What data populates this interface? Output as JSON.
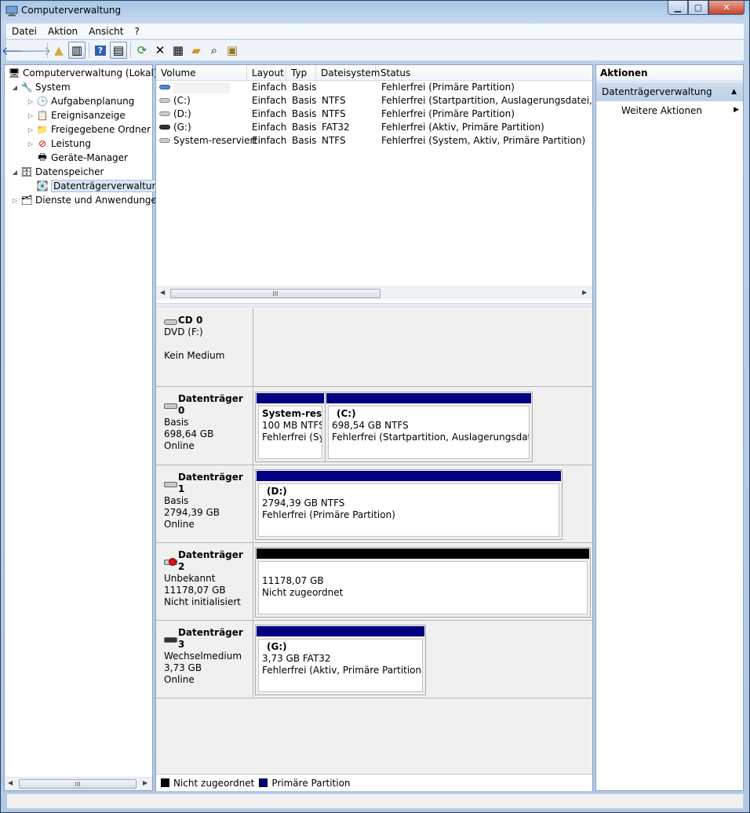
{
  "window": {
    "title": "Computerverwaltung"
  },
  "menu": [
    "Datei",
    "Aktion",
    "Ansicht",
    "?"
  ],
  "toolbar_icons": [
    "back-arrow-icon",
    "forward-arrow-icon",
    "up-folder-icon",
    "show-hide-tree-icon",
    "help-icon",
    "show-hide-action-pane-icon",
    "refresh-icon",
    "delete-icon",
    "properties-icon",
    "open-icon",
    "search-icon",
    "export-icon"
  ],
  "tree": [
    {
      "label": "Computerverwaltung (Lokal)",
      "level": 0,
      "arrow": "",
      "icon": "computer-management-icon"
    },
    {
      "label": "System",
      "level": 1,
      "arrow": "◢",
      "icon": "system-tools-icon"
    },
    {
      "label": "Aufgabenplanung",
      "level": 2,
      "arrow": "▷",
      "icon": "task-scheduler-icon"
    },
    {
      "label": "Ereignisanzeige",
      "level": 2,
      "arrow": "▷",
      "icon": "event-viewer-icon"
    },
    {
      "label": "Freigegebene Ordner",
      "level": 2,
      "arrow": "▷",
      "icon": "shared-folders-icon"
    },
    {
      "label": "Leistung",
      "level": 2,
      "arrow": "▷",
      "icon": "performance-icon"
    },
    {
      "label": "Geräte-Manager",
      "level": 2,
      "arrow": "",
      "icon": "device-manager-icon"
    },
    {
      "label": "Datenspeicher",
      "level": 1,
      "arrow": "◢",
      "icon": "storage-icon"
    },
    {
      "label": "Datenträgerverwaltung",
      "level": 2,
      "arrow": "",
      "icon": "disk-management-icon",
      "selected": true
    },
    {
      "label": "Dienste und Anwendungen",
      "level": 1,
      "arrow": "▷",
      "icon": "services-icon"
    }
  ],
  "volume_table": {
    "columns": [
      "Volume",
      "Layout",
      "Typ",
      "Dateisystem",
      "Status"
    ],
    "rows": [
      {
        "volume": "",
        "layout": "Einfach",
        "typ": "Basis",
        "fs": "",
        "status": "Fehlerfrei (Primäre Partition)",
        "icon": "blue"
      },
      {
        "volume": "(C:)",
        "layout": "Einfach",
        "typ": "Basis",
        "fs": "NTFS",
        "status": "Fehlerfrei (Startpartition, Auslagerungsdatei, Absturz",
        "icon": "gray"
      },
      {
        "volume": "(D:)",
        "layout": "Einfach",
        "typ": "Basis",
        "fs": "NTFS",
        "status": "Fehlerfrei (Primäre Partition)",
        "icon": "gray"
      },
      {
        "volume": "(G:)",
        "layout": "Einfach",
        "typ": "Basis",
        "fs": "FAT32",
        "status": "Fehlerfrei (Aktiv, Primäre Partition)",
        "icon": "dark"
      },
      {
        "volume": "System-reserviert",
        "layout": "Einfach",
        "typ": "Basis",
        "fs": "NTFS",
        "status": "Fehlerfrei (System, Aktiv, Primäre Partition)",
        "icon": "gray"
      }
    ]
  },
  "disks": [
    {
      "name": "CD 0",
      "lines": [
        "DVD (F:)",
        "",
        "Kein Medium"
      ],
      "icon": "cd"
    },
    {
      "name": "Datenträger 0",
      "lines": [
        "Basis",
        "698,64 GB",
        "Online"
      ],
      "icon": "hdd",
      "partitions": [
        {
          "title": "System-reser",
          "size": "100 MB NTFS",
          "status": "Fehlerfrei (Sys",
          "band": "#000080"
        },
        {
          "title": "(C:)",
          "size": "698,54 GB NTFS",
          "status": "Fehlerfrei (Startpartition, Auslagerungsdatei, Ab",
          "band": "#000080"
        }
      ]
    },
    {
      "name": "Datenträger 1",
      "lines": [
        "Basis",
        "2794,39 GB",
        "Online"
      ],
      "icon": "hdd",
      "partitions": [
        {
          "title": "(D:)",
          "size": "2794,39 GB NTFS",
          "status": "Fehlerfrei (Primäre Partition)",
          "band": "#000080"
        }
      ]
    },
    {
      "name": "Datenträger 2",
      "lines": [
        "Unbekannt",
        "11178,07 GB",
        "Nicht initialisiert"
      ],
      "icon": "hdd-error",
      "partitions": [
        {
          "title": "",
          "size": "11178,07 GB",
          "status": "Nicht zugeordnet",
          "band": "#000000"
        }
      ]
    },
    {
      "name": "Datenträger 3",
      "lines": [
        "Wechselmedium",
        "3,73 GB",
        "Online"
      ],
      "icon": "usb",
      "partitions": [
        {
          "title": "(G:)",
          "size": "3,73 GB FAT32",
          "status": "Fehlerfrei (Aktiv, Primäre Partition)",
          "band": "#000080"
        }
      ]
    }
  ],
  "legend": [
    {
      "label": "Nicht zugeordnet",
      "color": "#000000"
    },
    {
      "label": "Primäre Partition",
      "color": "#000080"
    }
  ],
  "actions": {
    "title": "Aktionen",
    "section": "Datenträgerverwaltung",
    "items": [
      "Weitere Aktionen"
    ]
  }
}
